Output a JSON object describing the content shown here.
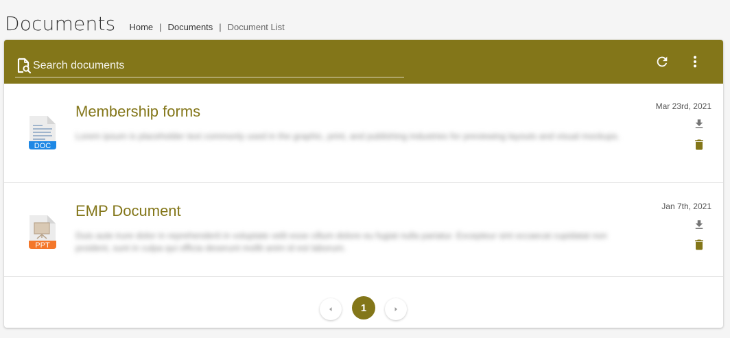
{
  "colors": {
    "accent": "#837619",
    "text": "#333333",
    "muted": "#666666"
  },
  "header": {
    "title": "Documents",
    "breadcrumbs": [
      "Home",
      "Documents",
      "Document List"
    ],
    "separator": "|"
  },
  "toolbar": {
    "search_icon": "file-search-icon",
    "search_placeholder": "Search documents",
    "search_value": "",
    "refresh_icon": "refresh-icon",
    "more_icon": "more-vertical-icon"
  },
  "documents": [
    {
      "title": "Membership forms",
      "date": "Mar 23rd, 2021",
      "file_type": "DOC",
      "file_color": "#1e88e5",
      "description": "Lorem ipsum is placeholder text commonly used in the graphic, print, and publishing industries for previewing layouts and visual mockups."
    },
    {
      "title": "EMP Document",
      "date": "Jan 7th, 2021",
      "file_type": "PPT",
      "file_color": "#f4772a",
      "description": "Duis aute irure dolor in reprehenderit in voluptate velit esse cillum dolore eu fugiat nulla pariatur. Excepteur sint occaecat cupidatat non proident, sunt in culpa qui officia deserunt mollit anim id est laborum."
    }
  ],
  "pagination": {
    "current_page": "1",
    "prev_icon": "chevron-left-icon",
    "next_icon": "chevron-right-icon"
  }
}
